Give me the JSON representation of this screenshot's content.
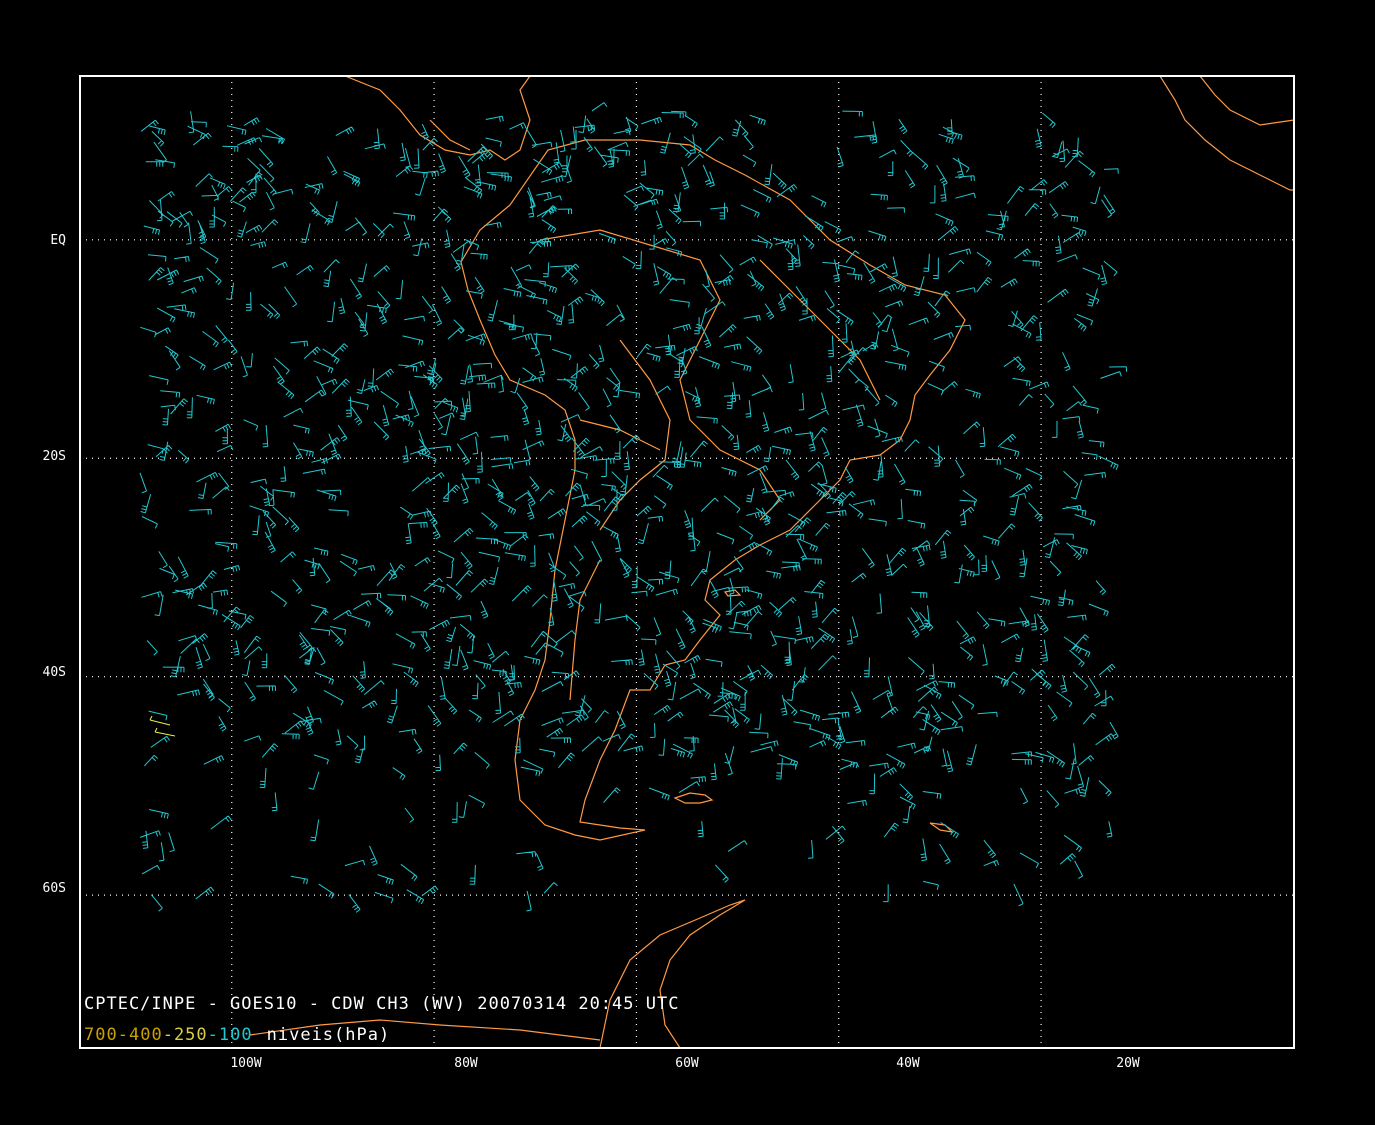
{
  "map": {
    "projection": "lat-lon",
    "lon_range": [
      -115,
      5
    ],
    "lat_range": [
      -74,
      15
    ],
    "lon_ticks": [
      {
        "lon": -100,
        "label": "100W"
      },
      {
        "lon": -80,
        "label": "80W"
      },
      {
        "lon": -60,
        "label": "60W"
      },
      {
        "lon": -40,
        "label": "40W"
      },
      {
        "lon": -20,
        "label": "20W"
      }
    ],
    "lat_ticks": [
      {
        "lat": 0,
        "label": "EQ"
      },
      {
        "lat": -20,
        "label": "20S"
      },
      {
        "lat": -40,
        "label": "40S"
      },
      {
        "lat": -60,
        "label": "60S"
      }
    ],
    "grid": "dotted",
    "colors": {
      "background": "#000000",
      "frame": "#ffffff",
      "coastline": "#ff9944",
      "wind_high": "#22c8d0",
      "wind_low": "#eeee55",
      "legend_700": "#c8a000",
      "legend_400": "#c8a000",
      "legend_250": "#d8d040",
      "legend_100": "#22c8d0"
    }
  },
  "title": "CPTEC/INPE - GOES10 - CDW CH3 (WV) 20070314 20:45 UTC",
  "legend": {
    "l700": "700",
    "l400": "400",
    "l250": "250",
    "l100": "100",
    "dash": "-",
    "suffix": "niveis(hPa)"
  }
}
